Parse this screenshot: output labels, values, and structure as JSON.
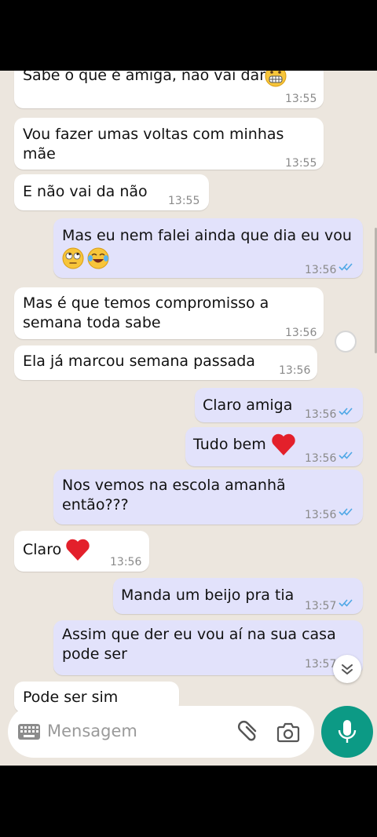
{
  "messages": [
    {
      "text": "Sabe o que é amiga, não vai dar",
      "time": "13:55",
      "direction": "in",
      "emoji": "grimacing-face"
    },
    {
      "text": "Vou fazer umas voltas com minhas\nmãe",
      "time": "13:55",
      "direction": "in"
    },
    {
      "text": "E não vai da não",
      "time": "13:55",
      "direction": "in"
    },
    {
      "text": "Mas eu nem falei ainda que dia eu vou",
      "time": "13:56",
      "direction": "out",
      "status": "read",
      "emoji": [
        "rolling-eyes-face",
        "tears-of-joy-face"
      ]
    },
    {
      "text": "Mas é que temos compromisso a\nsemana toda sabe",
      "time": "13:56",
      "direction": "in"
    },
    {
      "text": "Ela já marcou semana passada",
      "time": "13:56",
      "direction": "in"
    },
    {
      "text": "Claro amiga",
      "time": "13:56",
      "direction": "out",
      "status": "read"
    },
    {
      "text": "Tudo bem",
      "time": "13:56",
      "direction": "out",
      "status": "read",
      "emoji": "red-heart"
    },
    {
      "text": "Nos vemos na escola amanhã\nentão???",
      "time": "13:56",
      "direction": "out",
      "status": "read"
    },
    {
      "text": "Claro",
      "time": "13:56",
      "direction": "in",
      "emoji": "red-heart"
    },
    {
      "text": "Manda um beijo pra tia",
      "time": "13:57",
      "direction": "out",
      "status": "read"
    },
    {
      "text": "Assim que der eu vou aí na sua casa\npode ser",
      "time": "13:57",
      "direction": "out",
      "status": "read"
    },
    {
      "text": "Pode ser sim",
      "time": "",
      "direction": "in"
    }
  ],
  "composer": {
    "placeholder": "Mensagem",
    "icons": [
      "keyboard-icon",
      "attach-clip-icon",
      "camera-icon"
    ]
  },
  "mic_button": {
    "icon": "microphone-icon"
  },
  "colors": {
    "chat_background": "#ece6de",
    "incoming_bubble": "#ffffff",
    "outgoing_bubble": "#e2e2fb",
    "read_ticks": "#4fa8e6",
    "accent": "#0c9a85"
  }
}
